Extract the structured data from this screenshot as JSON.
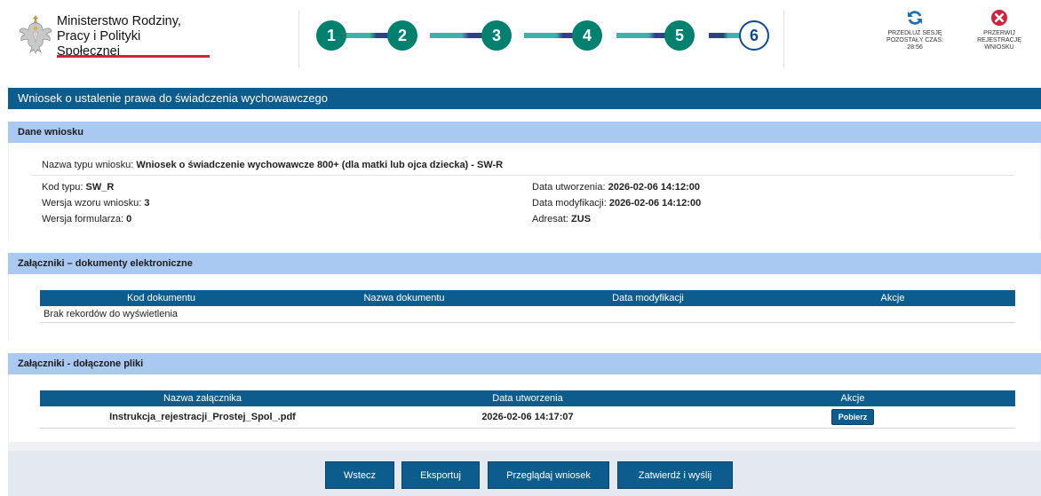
{
  "header": {
    "ministry_line1": "Ministerstwo Rodziny,",
    "ministry_line2": "Pracy i Polityki Społecznej",
    "steps": [
      "1",
      "2",
      "3",
      "4",
      "5",
      "6"
    ],
    "current_step": "6",
    "extend_session": {
      "line1": "PRZEDŁUŻ SESJĘ",
      "line2": "POZOSTAŁY CZAS:",
      "time": "28:56"
    },
    "abort": {
      "line1": "PRZERWIJ",
      "line2": "REJESTRACJĘ",
      "line3": "WNIOSKU"
    }
  },
  "page_title": "Wniosek o ustalenie prawa do świadczenia wychowawczego",
  "dane_wniosku": {
    "heading": "Dane wniosku",
    "type_name_label": "Nazwa typu wniosku:",
    "type_name_value": "Wniosek o świadczenie wychowawcze 800+ (dla matki lub ojca dziecka) - SW-R",
    "kod_typu_label": "Kod typu:",
    "kod_typu_value": "SW_R",
    "wersja_wzoru_label": "Wersja wzoru wniosku:",
    "wersja_wzoru_value": "3",
    "wersja_formularza_label": "Wersja formularza:",
    "wersja_formularza_value": "0",
    "data_utworzenia_label": "Data utworzenia:",
    "data_utworzenia_value": "2026-02-06 14:12:00",
    "data_modyfikacji_label": "Data modyfikacji:",
    "data_modyfikacji_value": "2026-02-06 14:12:00",
    "adresat_label": "Adresat:",
    "adresat_value": "ZUS"
  },
  "zalaczniki_elektroniczne": {
    "heading": "Załączniki – dokumenty elektroniczne",
    "columns": [
      "Kod dokumentu",
      "Nazwa dokumentu",
      "Data modyfikacji",
      "Akcje"
    ],
    "empty_text": "Brak rekordów do wyświetlenia"
  },
  "zalaczniki_pliki": {
    "heading": "Załączniki - dołączone pliki",
    "columns": [
      "Nazwa załącznika",
      "Data utworzenia",
      "Akcje"
    ],
    "rows": [
      {
        "name": "Instrukcja_rejestracji_Prostej_Spol_.pdf",
        "date": "2026-02-06 14:17:07",
        "action": "Pobierz"
      }
    ]
  },
  "footer": {
    "back": "Wstecz",
    "export": "Eksportuj",
    "preview": "Przeglądaj wniosek",
    "submit": "Zatwierdź i wyślij"
  },
  "colors": {
    "primary": "#0d5c8e",
    "section_header": "#a9c8f2",
    "step_done": "#00806f",
    "danger": "#d4213d"
  }
}
